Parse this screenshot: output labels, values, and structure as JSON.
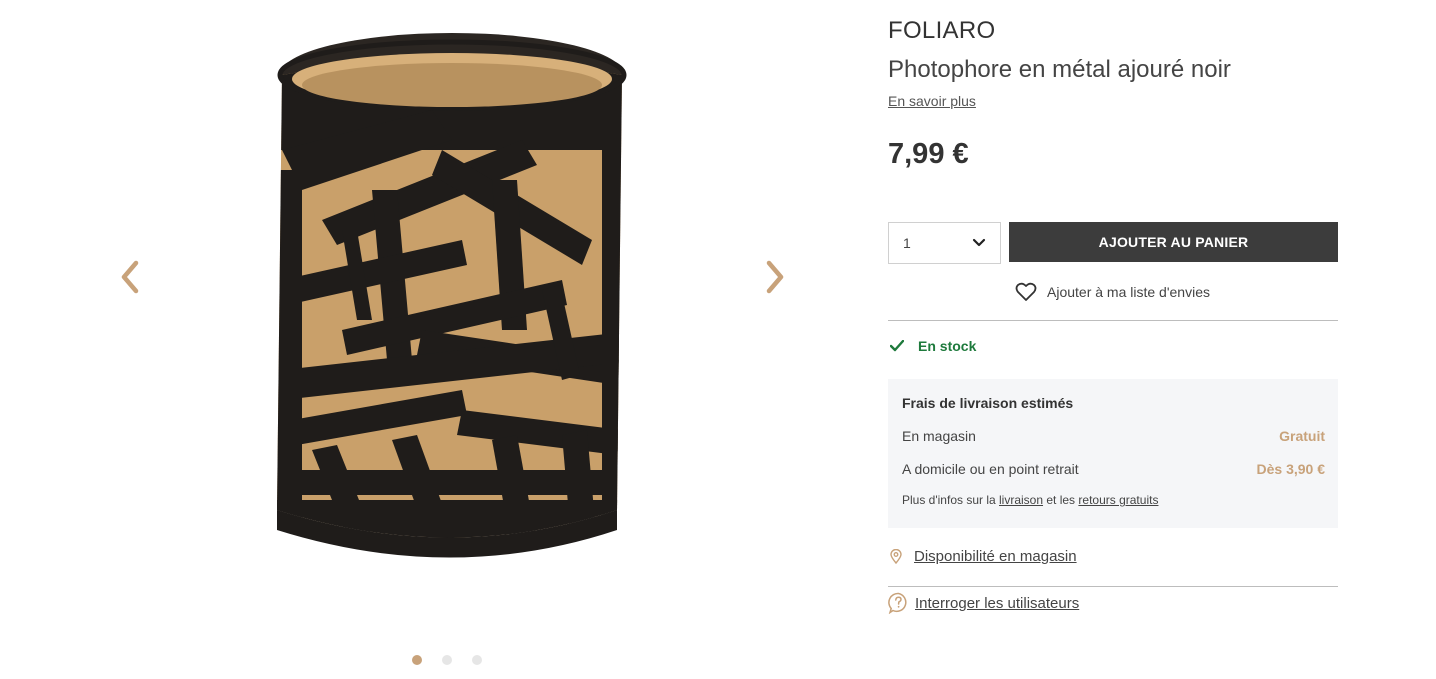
{
  "product": {
    "brand": "FOLIARO",
    "title": "Photophore en métal ajouré noir",
    "learn_more": "En savoir plus",
    "price": "7,99 €"
  },
  "purchase": {
    "quantity": "1",
    "add_to_cart": "AJOUTER AU PANIER",
    "wishlist": "Ajouter à ma liste d'envies"
  },
  "stock": {
    "status": "En stock"
  },
  "shipping": {
    "title": "Frais de livraison estimés",
    "rows": [
      {
        "label": "En magasin",
        "value": "Gratuit"
      },
      {
        "label": "A domicile ou en point retrait",
        "value": "Dès 3,90 €"
      }
    ],
    "note_prefix": "Plus d'infos sur la",
    "note_link1": "livraison",
    "note_mid": "et les",
    "note_link2": "retours gratuits"
  },
  "links": {
    "store_availability": "Disponibilité en magasin",
    "ask_users": "Interroger les utilisateurs"
  },
  "gallery": {
    "image_count": 3,
    "active_index": 0
  },
  "colors": {
    "accent": "#c8a27a",
    "button": "#3c3c3c",
    "stock_green": "#1e7a3c",
    "panel_bg": "#f5f6f8"
  },
  "icons": {
    "prev": "chevron-left-icon",
    "next": "chevron-right-icon",
    "quantity": "chevron-down-icon",
    "wishlist": "heart-icon",
    "stock": "check-icon",
    "store": "map-pin-icon",
    "ask": "question-bubble-icon"
  }
}
